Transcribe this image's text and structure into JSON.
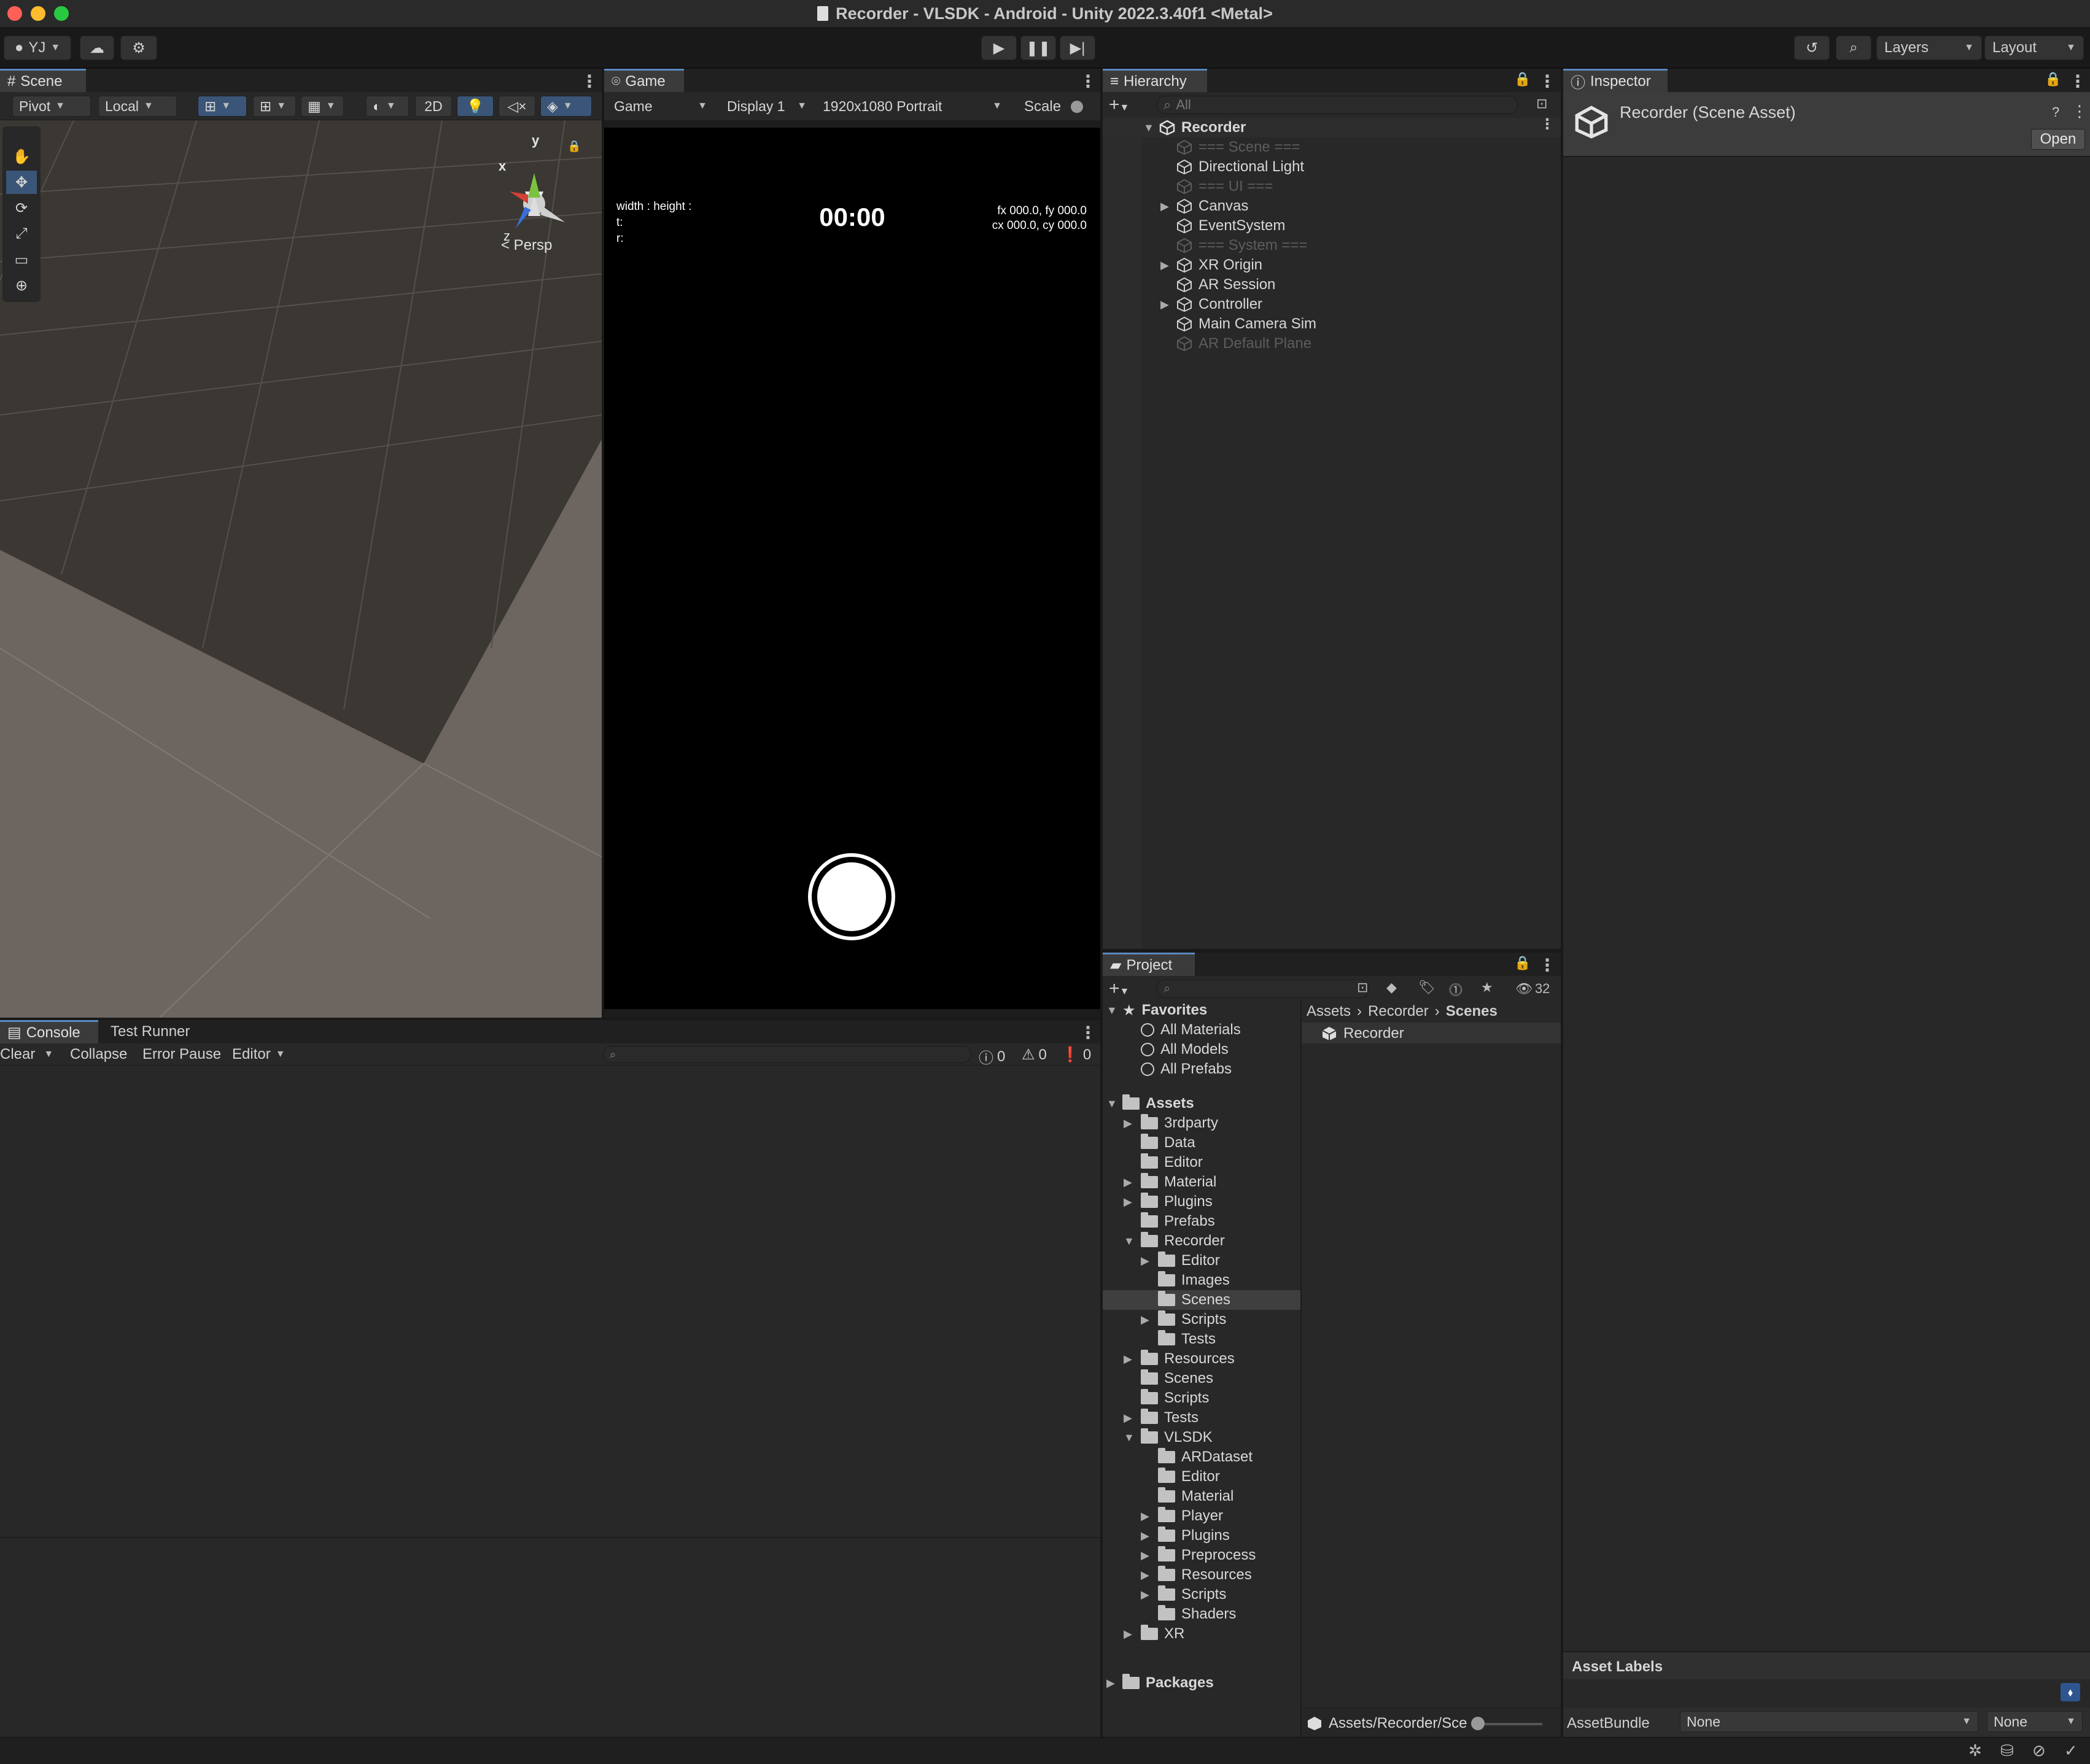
{
  "window": {
    "title": "Recorder - VLSDK - Android - Unity 2022.3.40f1 <Metal>"
  },
  "toolbar": {
    "account_label": "YJ",
    "layers_label": "Layers",
    "layout_label": "Layout"
  },
  "scene": {
    "tab_label": "Scene",
    "pivot_label": "Pivot",
    "local_label": "Local",
    "btn_2d": "2D",
    "gizmo_x": "x",
    "gizmo_y": "y",
    "gizmo_z": "z",
    "persp_label": "< Persp"
  },
  "game": {
    "tab_label": "Game",
    "mode_label": "Game",
    "display_label": "Display 1",
    "resolution_label": "1920x1080 Portrait",
    "scale_label": "Scale",
    "overlay_left_1": "width : height :",
    "overlay_left_2": "t:",
    "overlay_left_3": "r:",
    "timer": "00:00",
    "overlay_right_1": "fx 000.0, fy 000.0",
    "overlay_right_2": "cx 000.0, cy 000.0"
  },
  "hierarchy": {
    "tab_label": "Hierarchy",
    "search_placeholder": "All",
    "root": "Recorder",
    "items": [
      {
        "label": "=== Scene ===",
        "dim": true,
        "fold": false
      },
      {
        "label": "Directional Light",
        "dim": false,
        "fold": false
      },
      {
        "label": "=== UI ===",
        "dim": true,
        "fold": false
      },
      {
        "label": "Canvas",
        "dim": false,
        "fold": true
      },
      {
        "label": "EventSystem",
        "dim": false,
        "fold": false
      },
      {
        "label": "=== System ===",
        "dim": true,
        "fold": false
      },
      {
        "label": "XR Origin",
        "dim": false,
        "fold": true
      },
      {
        "label": "AR Session",
        "dim": false,
        "fold": false
      },
      {
        "label": "Controller",
        "dim": false,
        "fold": true
      },
      {
        "label": "Main Camera Sim",
        "dim": false,
        "fold": false
      },
      {
        "label": "AR Default Plane",
        "dim": true,
        "fold": false
      }
    ]
  },
  "inspector": {
    "tab_label": "Inspector",
    "asset_title": "Recorder (Scene Asset)",
    "open_button": "Open",
    "asset_labels": "Asset Labels",
    "assetbundle_label": "AssetBundle",
    "assetbundle_value": "None",
    "assetbundle_variant": "None"
  },
  "console": {
    "tab_label": "Console",
    "tab2_label": "Test Runner",
    "clear_label": "Clear",
    "collapse_label": "Collapse",
    "error_pause_label": "Error Pause",
    "editor_label": "Editor",
    "info_count": "0",
    "warn_count": "0",
    "error_count": "0"
  },
  "project": {
    "tab_label": "Project",
    "hidden_count": "32",
    "favorites_label": "Favorites",
    "favorites": [
      "All Materials",
      "All Models",
      "All Prefabs"
    ],
    "assets_label": "Assets",
    "tree": [
      {
        "label": "3rdparty",
        "depth": 1,
        "fold": "closed"
      },
      {
        "label": "Data",
        "depth": 1,
        "fold": "none"
      },
      {
        "label": "Editor",
        "depth": 1,
        "fold": "none"
      },
      {
        "label": "Material",
        "depth": 1,
        "fold": "closed"
      },
      {
        "label": "Plugins",
        "depth": 1,
        "fold": "closed"
      },
      {
        "label": "Prefabs",
        "depth": 1,
        "fold": "none"
      },
      {
        "label": "Recorder",
        "depth": 1,
        "fold": "open"
      },
      {
        "label": "Editor",
        "depth": 2,
        "fold": "closed"
      },
      {
        "label": "Images",
        "depth": 2,
        "fold": "none"
      },
      {
        "label": "Scenes",
        "depth": 2,
        "fold": "none",
        "selected": true
      },
      {
        "label": "Scripts",
        "depth": 2,
        "fold": "closed"
      },
      {
        "label": "Tests",
        "depth": 2,
        "fold": "none"
      },
      {
        "label": "Resources",
        "depth": 1,
        "fold": "closed"
      },
      {
        "label": "Scenes",
        "depth": 1,
        "fold": "none"
      },
      {
        "label": "Scripts",
        "depth": 1,
        "fold": "none"
      },
      {
        "label": "Tests",
        "depth": 1,
        "fold": "closed"
      },
      {
        "label": "VLSDK",
        "depth": 1,
        "fold": "open"
      },
      {
        "label": "ARDataset",
        "depth": 2,
        "fold": "none"
      },
      {
        "label": "Editor",
        "depth": 2,
        "fold": "none"
      },
      {
        "label": "Material",
        "depth": 2,
        "fold": "none"
      },
      {
        "label": "Player",
        "depth": 2,
        "fold": "closed"
      },
      {
        "label": "Plugins",
        "depth": 2,
        "fold": "closed"
      },
      {
        "label": "Preprocess",
        "depth": 2,
        "fold": "closed"
      },
      {
        "label": "Resources",
        "depth": 2,
        "fold": "closed"
      },
      {
        "label": "Scripts",
        "depth": 2,
        "fold": "closed"
      },
      {
        "label": "Shaders",
        "depth": 2,
        "fold": "none"
      },
      {
        "label": "XR",
        "depth": 1,
        "fold": "closed"
      }
    ],
    "packages_label": "Packages",
    "breadcrumb": [
      "Assets",
      "Recorder",
      "Scenes"
    ],
    "files": [
      "Recorder"
    ],
    "footer_path": "Assets/Recorder/Sce"
  },
  "colors": {
    "accent": "#5a8ac0",
    "panel_bg": "#282828",
    "selected_row": "#3f3f3f"
  }
}
